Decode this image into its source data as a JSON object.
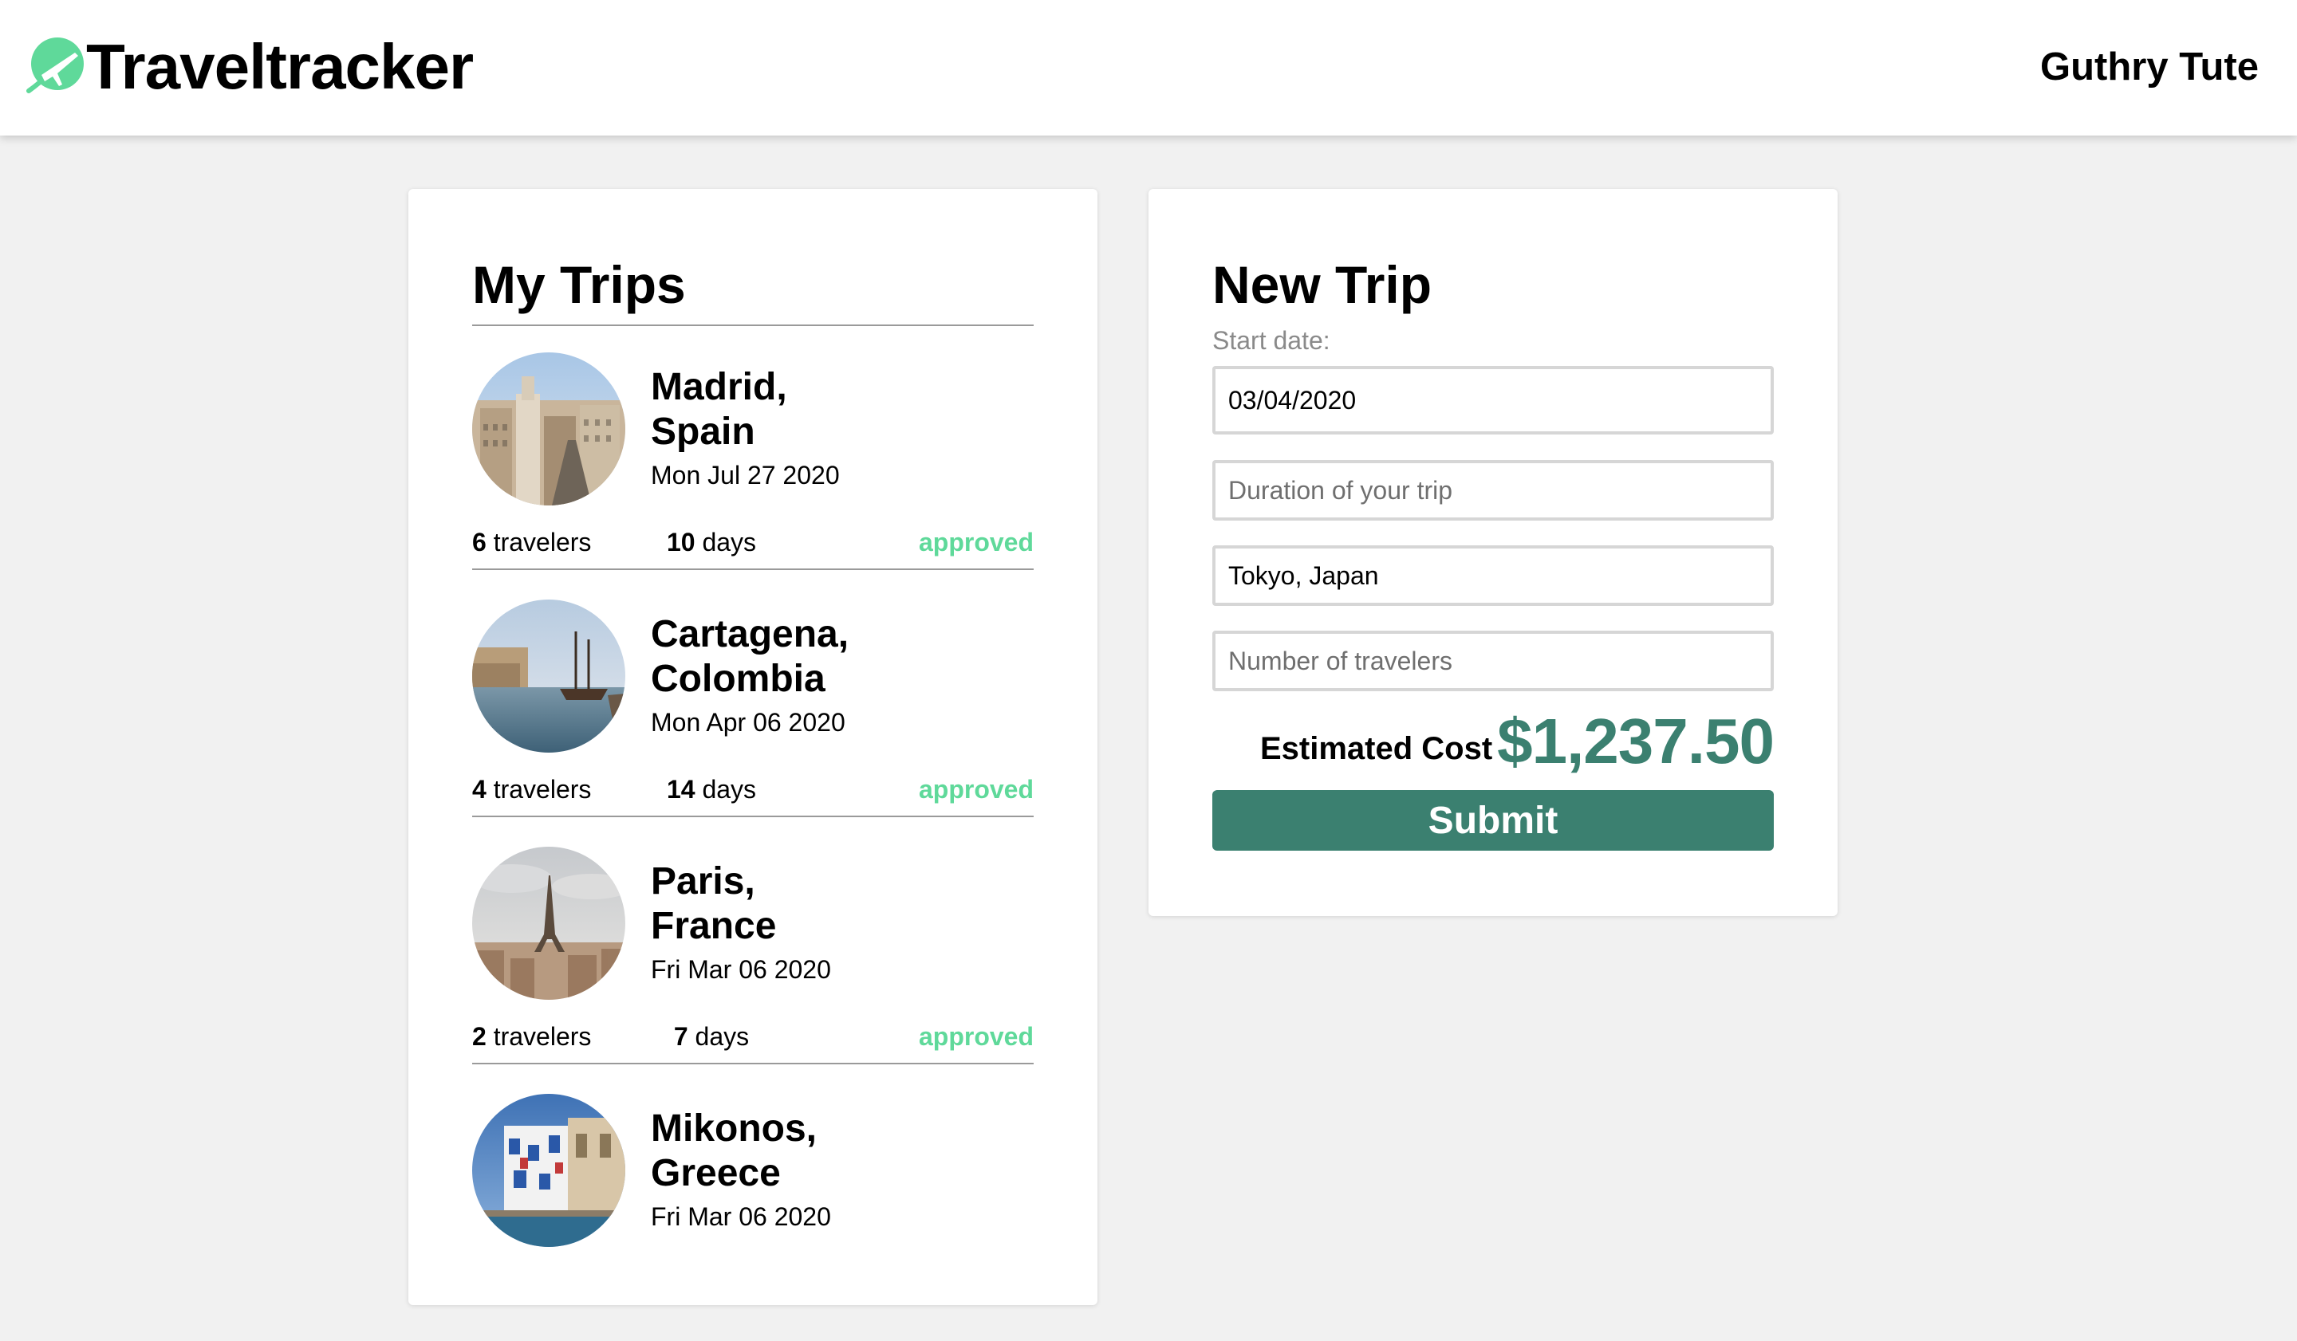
{
  "header": {
    "brand": "Traveltracker",
    "logo_icon": "plane-globe-icon",
    "username": "Guthry Tute"
  },
  "colors": {
    "accent": "#3b8070",
    "approved": "#5fd99a",
    "logo": "#5fd99a",
    "page_bg": "#f1f1f1"
  },
  "my_trips": {
    "title": "My Trips",
    "trips": [
      {
        "destination_line1": "Madrid,",
        "destination_line2": "Spain",
        "date": "Mon Jul 27 2020",
        "travelers_count": "6",
        "travelers_word": "travelers",
        "days_count": "10",
        "days_word": "days",
        "status": "approved",
        "photo": "madrid-cityscape"
      },
      {
        "destination_line1": "Cartagena,",
        "destination_line2": "Colombia",
        "date": "Mon Apr 06 2020",
        "travelers_count": "4",
        "travelers_word": "travelers",
        "days_count": "14",
        "days_word": "days",
        "status": "approved",
        "photo": "cartagena-harbor"
      },
      {
        "destination_line1": "Paris,",
        "destination_line2": "France",
        "date": "Fri Mar 06 2020",
        "travelers_count": "2",
        "travelers_word": "travelers",
        "days_count": "7",
        "days_word": "days",
        "status": "approved",
        "photo": "paris-eiffel-tower"
      },
      {
        "destination_line1": "Mikonos,",
        "destination_line2": "Greece",
        "date": "Fri Mar 06 2020",
        "photo": "mikonos-waterfront"
      }
    ]
  },
  "new_trip": {
    "title": "New Trip",
    "start_date_label": "Start date:",
    "start_date_value": "03/04/2020",
    "duration_value": "",
    "duration_placeholder": "Duration of your trip",
    "destination_value": "Tokyo, Japan",
    "travelers_value": "",
    "travelers_placeholder": "Number of travelers",
    "estimated_cost_label": "Estimated Cost",
    "estimated_cost_value": "$1,237.50",
    "submit_label": "Submit"
  }
}
